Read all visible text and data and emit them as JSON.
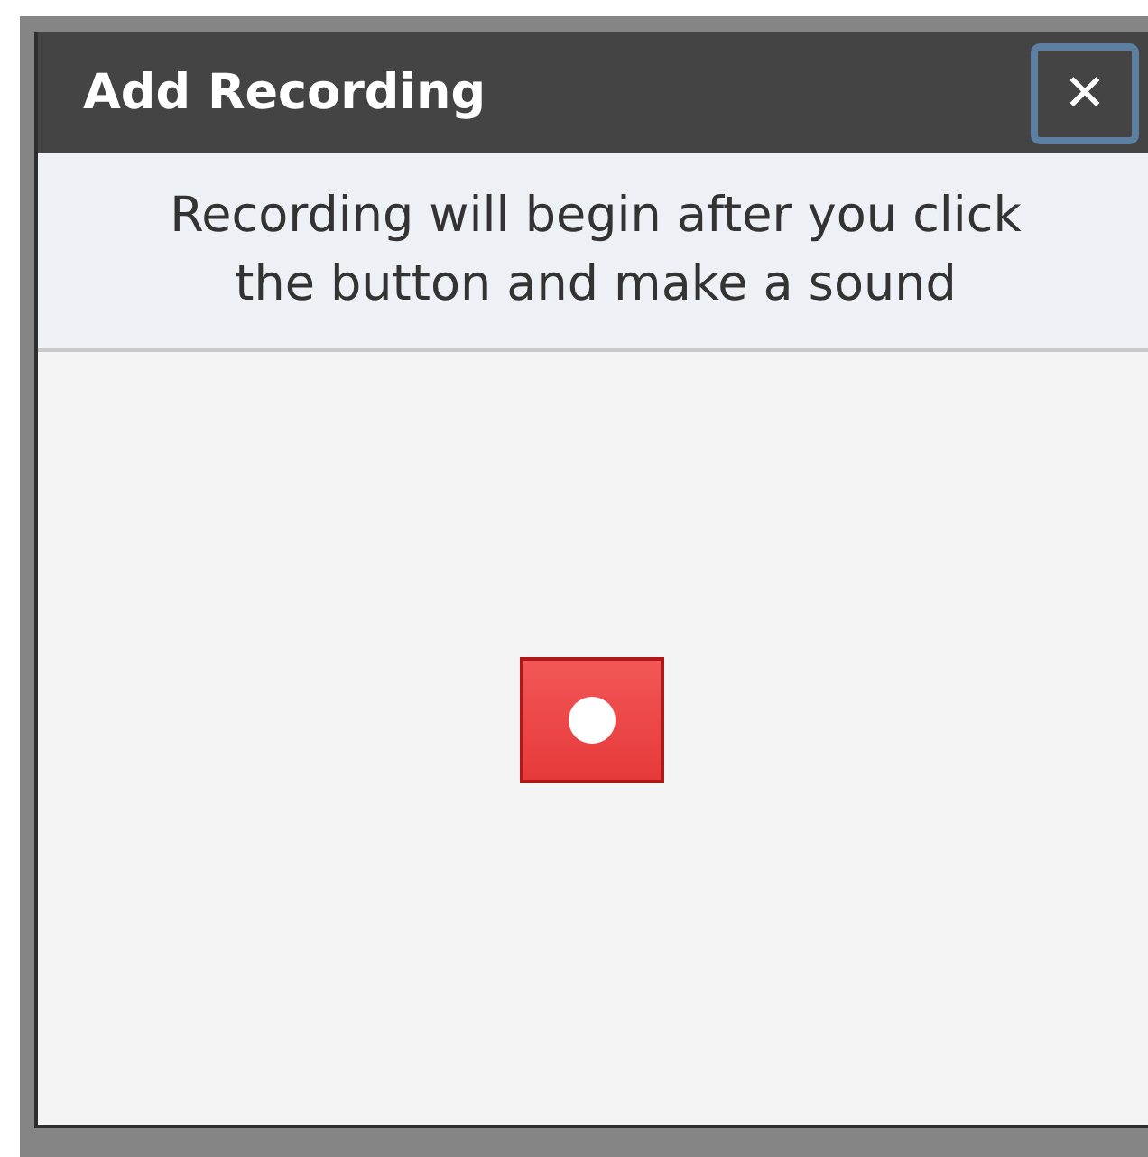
{
  "dialog": {
    "title": "Add Recording",
    "close_label": "✕",
    "instructions": "Recording will begin after you click the button and make a sound"
  }
}
